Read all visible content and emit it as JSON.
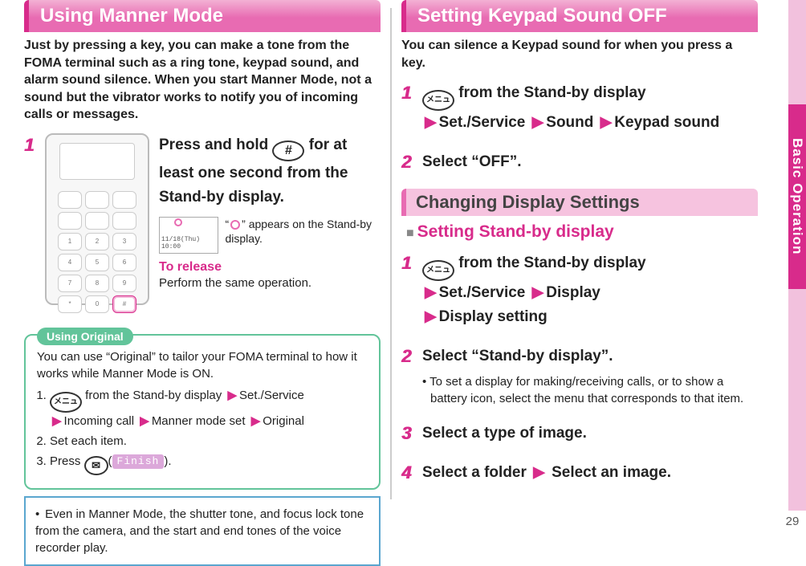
{
  "page_number": "29",
  "side_tab": "Basic Operation",
  "left": {
    "header": "Using Manner Mode",
    "intro": "Just by pressing a key, you can make a tone from the FOMA terminal such as a ring tone, keypad sound, and alarm sound silence. When you start Manner Mode, not a sound but the vibrator works to notify you of incoming calls or messages.",
    "step1_num": "1",
    "press_hold_1": "Press and hold ",
    "press_hold_2": " for at least one second from the Stand-by display.",
    "hash_key": "#",
    "mini_screen_text": "11/18(Thu) 10:00",
    "appears_text_1": "“",
    "appears_text_2": "” appears on the Stand-by display.",
    "to_release_label": "To release",
    "to_release_text": "Perform the same operation.",
    "using_original_label": "Using Original",
    "uo_intro": "You can use “Original” to tailor your FOMA terminal to how it works while Manner Mode is ON.",
    "uo1_a": " from the Stand-by display",
    "uo1_paths": [
      "Set./Service",
      "Incoming call",
      "Manner mode set",
      "Original"
    ],
    "uo2": "Set each item.",
    "uo3_a": "Press ",
    "uo3_finish": "Finish",
    "note_text": "Even in Manner Mode, the shutter tone, and focus lock tone from the camera, and the start and end tones of the voice recorder play.",
    "menu_key": "メニュ",
    "mail_key": "✉"
  },
  "right": {
    "header1": "Setting Keypad Sound OFF",
    "intro1": "You can silence a Keypad sound for when you press a key.",
    "s1_num": "1",
    "s1_a": " from the Stand-by display",
    "s1_paths": [
      "Set./Service",
      "Sound",
      "Keypad sound"
    ],
    "s2_num": "2",
    "s2_text": "Select “OFF”.",
    "header2": "Changing Display Settings",
    "sub_inline_bar": "■",
    "sub_inline": "Setting Stand-by display",
    "d1_num": "1",
    "d1_a": " from the Stand-by display",
    "d1_paths": [
      "Set./Service",
      "Display",
      "Display setting"
    ],
    "d2_num": "2",
    "d2_text": "Select “Stand-by display”.",
    "d2_sub_bullet": "• ",
    "d2_sub": "To set a display for making/receiving calls, or to show a battery icon, select the menu that corresponds to that item.",
    "d3_num": "3",
    "d3_text": "Select a type of image.",
    "d4_num": "4",
    "d4_text_a": "Select a folder",
    "d4_text_b": "Select an image.",
    "menu_key": "メニュ"
  },
  "arrows": {
    "right": "▶"
  }
}
